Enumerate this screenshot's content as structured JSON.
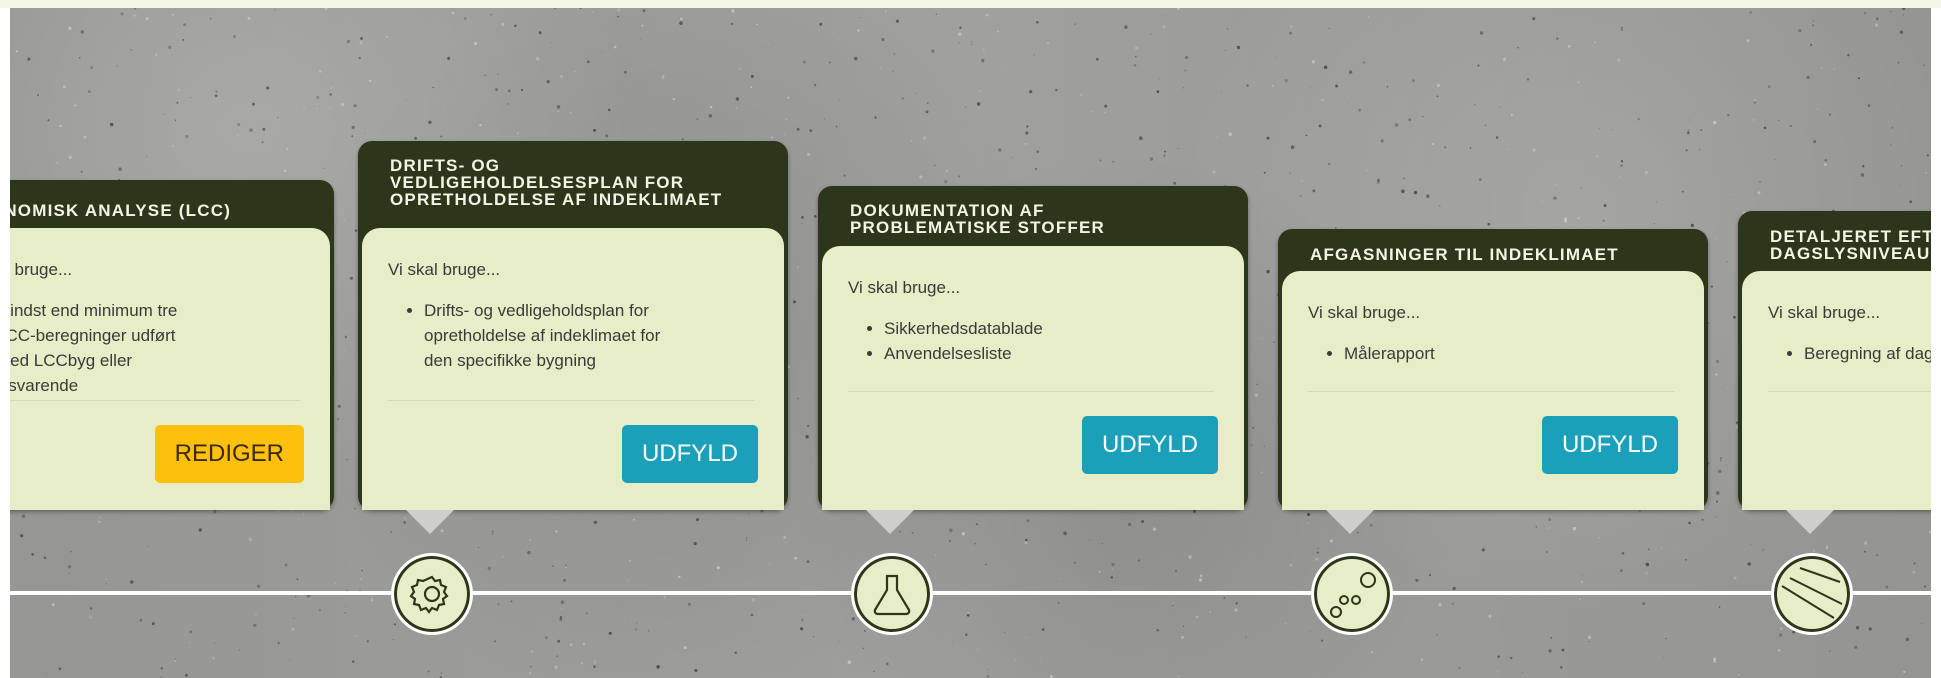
{
  "cards": [
    {
      "title": "ØKONOMISK ANALYSE (LCC)",
      "intro": "Vi skal bruge...",
      "items": [
        "Mindst end minimum tre LCC-beregninger udført med LCCbyg eller tilsvarende"
      ],
      "button": "REDIGER",
      "button_color": "#fdc00c",
      "icon": "none"
    },
    {
      "title": "DRIFTS- OG\nVEDLIGEHOLDELSESPLAN FOR\nOPRETHOLDELSE AF INDEKLIMAET",
      "intro": "Vi skal bruge...",
      "items": [
        "Drifts- og vedligeholdsplan for opretholdelse af indeklimaet for den specifikke bygning"
      ],
      "button": "UDFYLD",
      "button_color": "#1aa0b8",
      "icon": "gear-icon"
    },
    {
      "title": "DOKUMENTATION AF\nPROBLEMATISKE STOFFER",
      "intro": "Vi skal bruge...",
      "items": [
        "Sikkerhedsdatablade",
        "Anvendelsesliste"
      ],
      "button": "UDFYLD",
      "button_color": "#1aa0b8",
      "icon": "flask-icon"
    },
    {
      "title": "AFGASNINGER TIL INDEKLIMAET",
      "intro": "Vi skal bruge...",
      "items": [
        "Målerapport"
      ],
      "button": "UDFYLD",
      "button_color": "#1aa0b8",
      "icon": "particles-icon"
    },
    {
      "title": "DETALJERET EFTERVISNING AF\nDAGSLYSNIVEAUET",
      "intro": "Vi skal bruge...",
      "items": [
        "Beregning af dagslysniveauet"
      ],
      "button": "",
      "button_color": "#1aa0b8",
      "icon": "window-icon"
    }
  ],
  "colors": {
    "header": "#2d361a",
    "body": "#e7edc7",
    "timeline": "#ffffff"
  }
}
